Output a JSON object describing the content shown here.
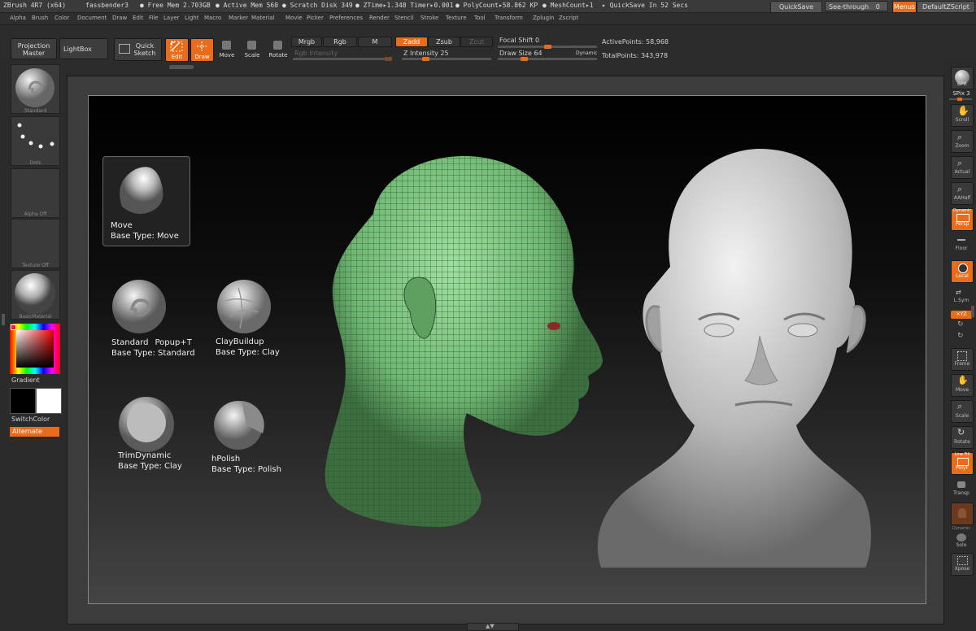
{
  "titlebar": {
    "app": "ZBrush 4R7 (x64)",
    "user": "fassbender3",
    "free_mem": "● Free Mem 2.703GB",
    "active_mem": "● Active Mem 560",
    "scratch": "● Scratch Disk 349",
    "ztime": "● ZTime▸1.348 Timer▸0.001",
    "polycount": "● PolyCount▸58.862 KP",
    "meshcount": "● MeshCount▸1",
    "quicksave_timer": "▸ QuickSave In 52 Secs",
    "quicksave_btn": "QuickSave",
    "seethrough_label": "See-through",
    "seethrough_value": "0",
    "menus_btn": "Menus",
    "script_btn": "DefaultZScript"
  },
  "menubar": [
    "Alpha",
    "Brush",
    "Color",
    "Document",
    "Draw",
    "Edit",
    "File",
    "Layer",
    "Light",
    "Macro",
    "Marker",
    "Material",
    "Movie",
    "Picker",
    "Preferences",
    "Render",
    "Stencil",
    "Stroke",
    "Texture",
    "Tool",
    "Transform",
    "Zplugin",
    "Zscript"
  ],
  "toolbar": {
    "projection_master": "Projection Master",
    "lightbox": "LightBox",
    "quick_sketch": "Quick Sketch",
    "edit": "Edit",
    "draw": "Draw",
    "move": "Move",
    "scale": "Scale",
    "rotate": "Rotate",
    "mrgb": "Mrgb",
    "rgb": "Rgb",
    "m": "M",
    "zadd": "Zadd",
    "zsub": "Zsub",
    "zcut": "Zcut",
    "rgb_intensity": "Rgb Intensity",
    "z_intensity": "Z Intensity 25",
    "focal_shift": "Focal Shift 0",
    "draw_size": "Draw Size 64",
    "dynamic": "Dynamic",
    "active_points": "ActivePoints: 58,968",
    "total_points": "TotalPoints: 343,978"
  },
  "levels": {
    "rgb_intensity": 1.0,
    "z_intensity": 0.25,
    "focal_shift": 0.5,
    "draw_size": 0.25
  },
  "leftshelf": {
    "brush": "Standard",
    "stroke": "Dots",
    "alpha": "Alpha Off",
    "texture": "Texture Off",
    "material": "BasicMaterial",
    "gradient": "Gradient",
    "switchcolor": "SwitchColor",
    "alternate": "Alternate"
  },
  "canvas": {
    "brushes": [
      {
        "name": "Move",
        "type": "Base Type: Move"
      },
      {
        "name": "Standard",
        "extra": "Popup+T",
        "type": "Base Type: Standard"
      },
      {
        "name": "ClayBuildup",
        "type": "Base Type: Clay"
      },
      {
        "name": "TrimDynamic",
        "type": "Base Type: Clay"
      },
      {
        "name": "hPolish",
        "type": "Base Type: Polish"
      }
    ]
  },
  "rightshelf": {
    "bpr": "BPR",
    "spix": "SPix 3",
    "scroll": "Scroll",
    "zoom": "Zoom",
    "actual": "Actual",
    "aahalf": "AAHalf",
    "dynamic": "Dynamic",
    "persp": "Persp",
    "floor": "Floor",
    "local": "Local",
    "lsym": "L.Sym",
    "xyz": "✕YZ",
    "frame": "Frame",
    "move": "Move",
    "scale": "Scale",
    "rotate": "Rotate",
    "linefill": "Line Fill",
    "polyf": "PolyF",
    "transp": "Transp",
    "dynamic2": "Dynamic",
    "solo": "Solo",
    "xpose": "Xpose"
  },
  "colors": {
    "accent": "#e86c1a",
    "mesh_green": "#79c77c",
    "wire": "#2f4f31"
  }
}
